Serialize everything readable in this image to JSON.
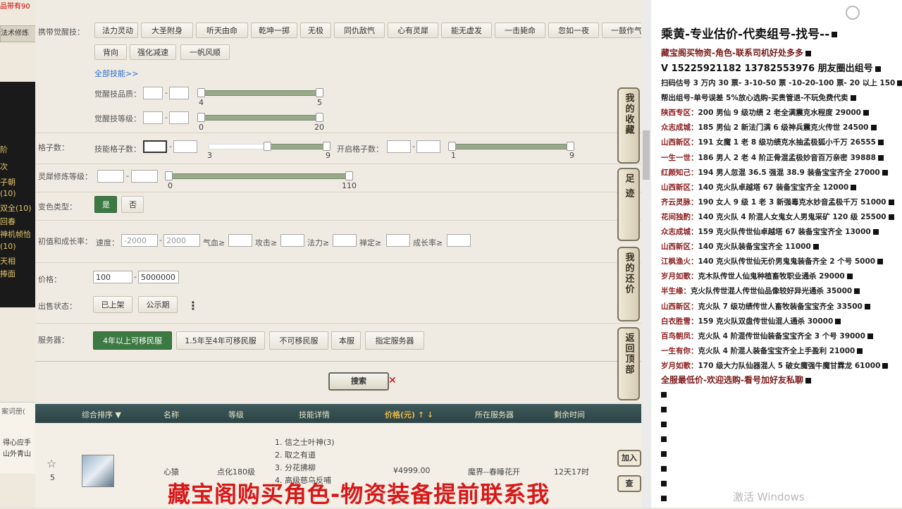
{
  "left_strip": {
    "top_text": "品带有90",
    "tab_label": "法术修炼",
    "dark_items": [
      "阶",
      "次",
      "子朝",
      "(10)",
      "双全(10)",
      "回春",
      "神机帧恰",
      "(10)",
      "天相",
      "捧面"
    ],
    "bottom_tab": "案词册(",
    "bottom_lines": [
      "得心应手",
      "山外青山"
    ]
  },
  "filters": {
    "carry_awaken_label": "携带觉醒技：",
    "awaken_skills_row1": [
      "法力灵动",
      "大圣附身",
      "听天由命",
      "乾坤一掷",
      "无极",
      "同仇敌忾",
      "心有灵犀",
      "能无虚发",
      "一击毙命",
      "忽如一夜",
      "一鼓作气"
    ],
    "awaken_skills_row2": [
      "背向",
      "强化减速",
      "一帆风顺"
    ],
    "all_skills_link": "全部技能>>",
    "awaken_quality_label": "觉醒技品质：",
    "awaken_quality_min": "4",
    "awaken_quality_max": "5",
    "awaken_level_label": "觉醒技等级：",
    "awaken_level_min": "0",
    "awaken_level_max": "20",
    "slots_label": "格子数：",
    "skill_slots_label": "技能格子数：",
    "skill_slots_min": "3",
    "skill_slots_max": "9",
    "open_slots_label": "开启格子数：",
    "open_slots_min": "1",
    "open_slots_max": "9",
    "spirit_label": "灵犀修炼等级：",
    "spirit_min": "0",
    "spirit_max": "110",
    "variant_label": "变色类型：",
    "variant_yes": "是",
    "variant_no": "否",
    "growth_label": "初值和成长率：",
    "speed_label": "速度：",
    "speed_min_ph": "-2000",
    "speed_max_ph": "2000",
    "hp_label": "气血≥",
    "atk_label": "攻击≥",
    "mana_label": "法力≥",
    "zen_label": "禅定≥",
    "growth_rate_label": "成长率≥",
    "price_label": "价格：",
    "price_min": "100",
    "price_max": "5000000",
    "sale_label": "出售状态：",
    "sale_listed": "已上架",
    "sale_public": "公示期",
    "more_icon": "⋮",
    "server_label": "服务器：",
    "server_options": [
      "4年以上可移民服",
      "1.5年至4年可移民服",
      "不可移民服",
      "本服",
      "指定服务器"
    ],
    "search_button": "搜索"
  },
  "table": {
    "headers": [
      "综合排序 ▼",
      "名称",
      "等级",
      "技能详情",
      "价格(元) ↑ ↓",
      "所在服务器",
      "剩余时间"
    ],
    "row": {
      "rank": "5",
      "name": "心猿",
      "level": "点化180级",
      "skills": [
        "1. 信之士叶神(3)",
        "2. 取之有道",
        "3. 分花拂柳",
        "4. 高级慈乌反哺"
      ],
      "price": "¥4999.00",
      "server": "魔界--春睡花开",
      "time_left": "12天17时"
    }
  },
  "side_tabs": [
    "我的收藏",
    "足迹",
    "我的还价",
    "返回顶部"
  ],
  "mini_buttons": [
    "加入",
    "查"
  ],
  "right_panel": {
    "title": "乘黄-专业估价-代卖组号-找号--",
    "subtitle1": "藏宝阁买物资-角色-联系司机好处多多",
    "subtitle2": "V 15225921182  13782553976 朋友圈出组号",
    "lines": [
      "扫码估号 3 万内 30 票- 3-10-50 票 -10-20-100 票- 20 以上 150",
      "帮出组号-单号误差 5%放心选购-买贵管退-不玩免费代卖",
      "陕西专区：200 男仙 9 级功绩 2 老全满震克水程度 29000",
      "众志成城：185 男仙 2 新法门满 6 级神兵震克火传世 24500",
      "山西新区：191 女魔 1 老 8 级功绩克水抽孟极狐小千万 26555",
      "一生一世：186 男人 2 老 4 阶正骨混孟极妙音百万亲密 39888",
      "红颜知己：194 男人忽混 36.5 强混 38.9 装备宝宝齐全 27000",
      "山西新区：140 克火队卓越塔 67 装备宝宝齐全 12000",
      "齐云灵脉：190 女人 9 级 1 老 3 新强毒克水妙音孟极千万 51000",
      "花间独酌：140 克火队 4 阶混人女鬼女人男鬼采矿 120 级 25500",
      "众志成城：159 克火队传世仙卓越塔 67 装备宝宝齐全 13000",
      "山西新区：140 克火队装备宝宝齐全 11000",
      "江枫渔火：140 克火队传世仙无价男鬼鬼装备齐全 2 个号 5000",
      "岁月如歌：克木队传世人仙鬼种植畜牧职业通杀 29000",
      "半生缘：克火队传世混人传世仙品像较好异光通杀 35000",
      "山西新区：克火队 7 级功绩传世人畜牧装备宝宝齐全 33500",
      "白衣胜雪：159 克火队双盘传世仙混人通杀 30000",
      "百鸟朝凤：克火队 4 阶混传世仙装备宝宝齐全 3 个号 39000",
      "一生有你：克火队 4 阶混人装备宝宝齐全上手盈利 21000",
      "岁月如歌：170 级大力队仙器混人 5 破女魔强牛魔甘霖龙 61000"
    ],
    "footer": "全服最低价-欢迎选购-看号加好友私聊"
  },
  "overlay_text": "藏宝阁购买角色-物资装备提前联系我",
  "windows_watermark": "激活 Windows",
  "colors": {
    "accent_green": "#3d7a43",
    "overlay_red": "#d81818",
    "header_teal": "#2c4344",
    "link_blue": "#2f6fd1"
  }
}
